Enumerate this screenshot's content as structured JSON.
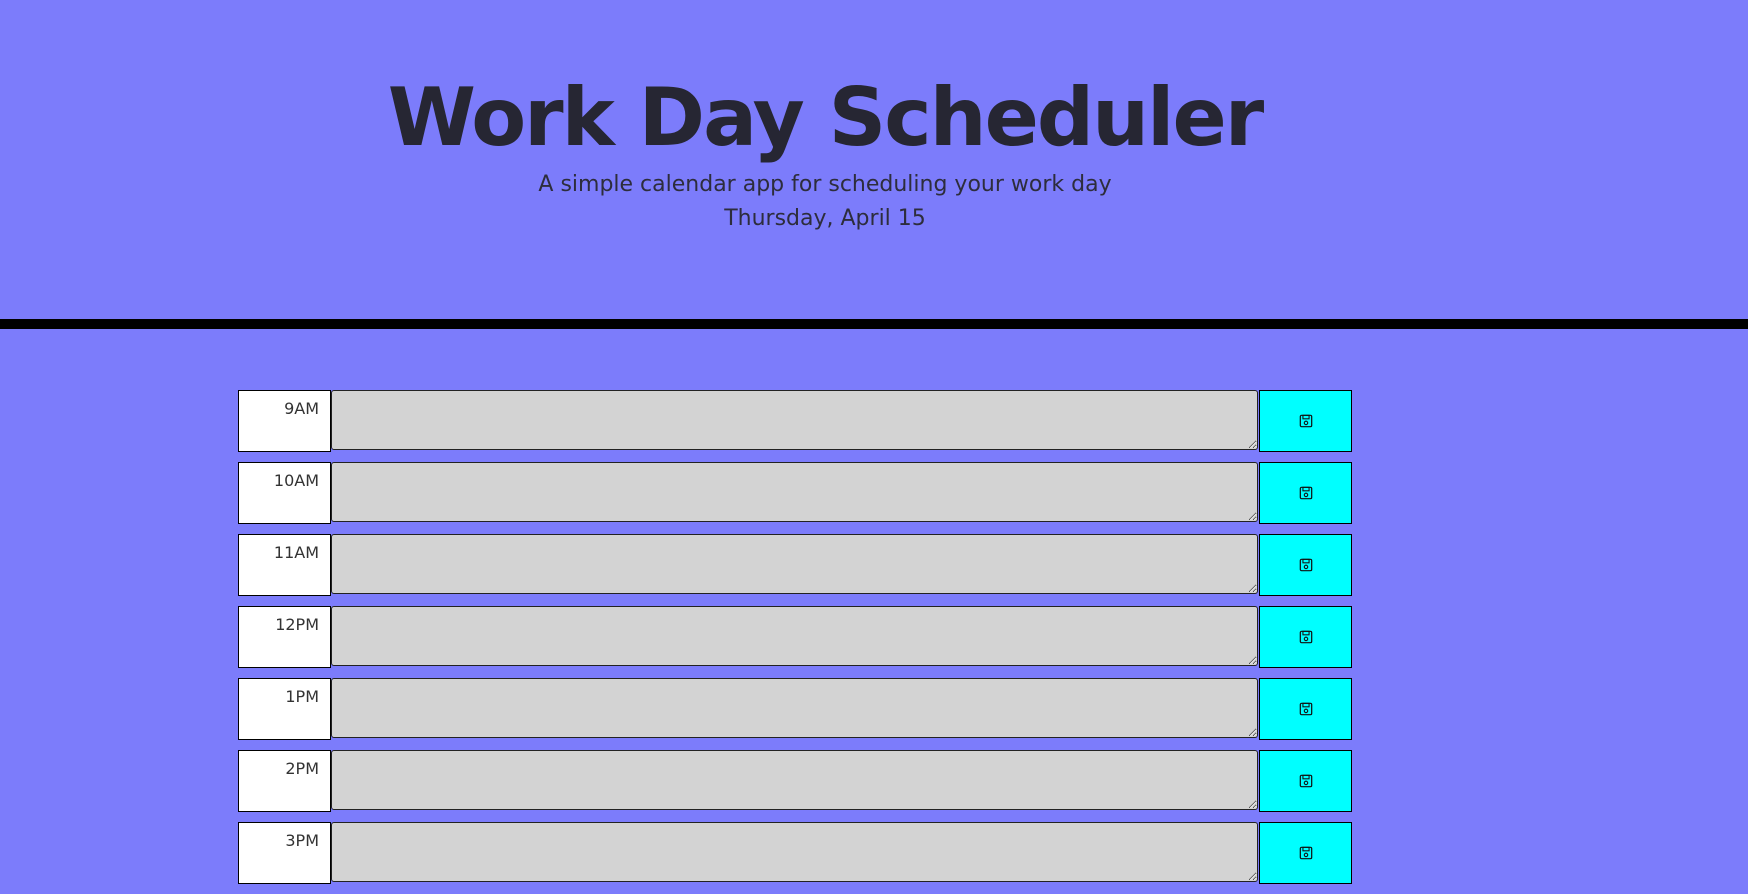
{
  "header": {
    "title": "Work Day Scheduler",
    "lead": "A simple calendar app for scheduling your work day",
    "current_day": "Thursday, April 15"
  },
  "colors": {
    "background": "#7c7cfb",
    "save_button": "#00ffff",
    "textarea": "#d3d3d3",
    "hour_box": "#ffffff",
    "divider": "#000000"
  },
  "timeblocks": [
    {
      "hour": "9AM",
      "description": "",
      "save_icon": "floppy-disk-icon"
    },
    {
      "hour": "10AM",
      "description": "",
      "save_icon": "floppy-disk-icon"
    },
    {
      "hour": "11AM",
      "description": "",
      "save_icon": "floppy-disk-icon"
    },
    {
      "hour": "12PM",
      "description": "",
      "save_icon": "floppy-disk-icon"
    },
    {
      "hour": "1PM",
      "description": "",
      "save_icon": "floppy-disk-icon"
    },
    {
      "hour": "2PM",
      "description": "",
      "save_icon": "floppy-disk-icon"
    },
    {
      "hour": "3PM",
      "description": "",
      "save_icon": "floppy-disk-icon"
    }
  ]
}
